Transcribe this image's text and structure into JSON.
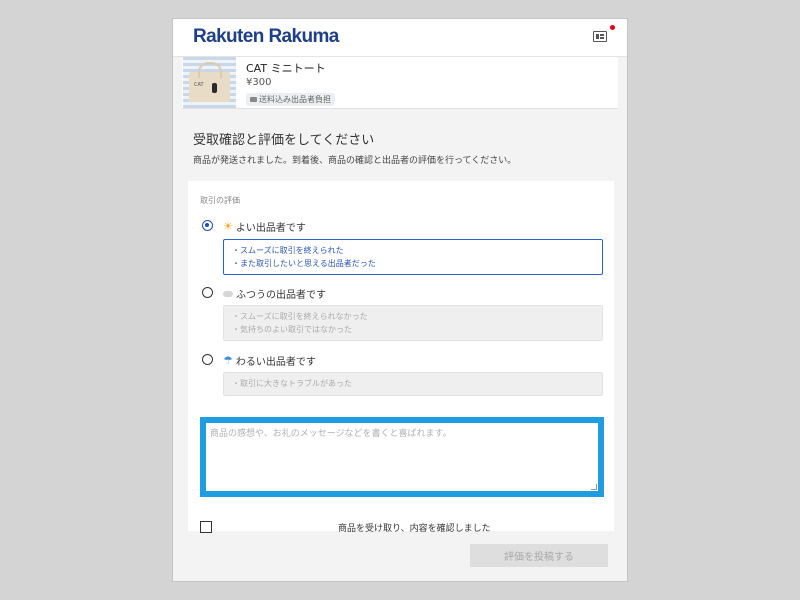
{
  "header": {
    "logo": "Rakuten Rakuma",
    "id_card_icon": "id-card-icon",
    "notification_color": "#e60012"
  },
  "product": {
    "name": "CAT ミニトート",
    "price": "¥300",
    "shipping": "送料込み出品者負担"
  },
  "page": {
    "heading": "受取確認と評価をしてください",
    "subtext": "商品が発送されました。到着後、商品の確認と出品者の評価を行ってください。"
  },
  "rating": {
    "section_label": "取引の評価",
    "selected": "good",
    "options": [
      {
        "key": "good",
        "icon": "sun-icon",
        "label": "よい出品者です",
        "lines": [
          "・スムーズに取引を終えられた",
          "・また取引したいと思える出品者だった"
        ]
      },
      {
        "key": "normal",
        "icon": "cloud-icon",
        "label": "ふつうの出品者です",
        "lines": [
          "・スムーズに取引を終えられなかった",
          "・気持ちのよい取引ではなかった"
        ]
      },
      {
        "key": "bad",
        "icon": "umbrella-icon",
        "label": "わるい出品者です",
        "lines": [
          "・取引に大きなトラブルがあった"
        ]
      }
    ]
  },
  "comment": {
    "placeholder": "商品の感想や、お礼のメッセージなどを書くと喜ばれます。",
    "value": ""
  },
  "confirm": {
    "label": "商品を受け取り、内容を確認しました",
    "checked": false
  },
  "submit": {
    "label": "評価を投稿する",
    "enabled": false
  },
  "colors": {
    "brand": "#1f3f86",
    "accent": "#2f5fd0",
    "focus_ring": "#1e9de0"
  }
}
